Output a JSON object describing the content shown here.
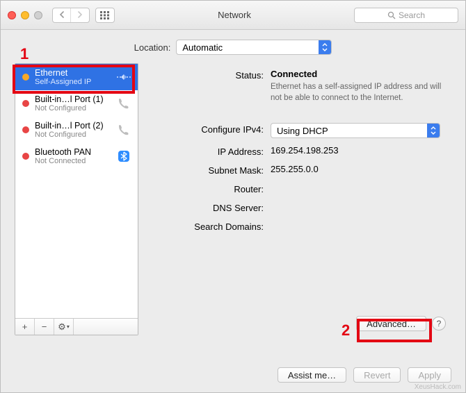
{
  "window": {
    "title": "Network"
  },
  "search": {
    "placeholder": "Search"
  },
  "location": {
    "label": "Location:",
    "value": "Automatic"
  },
  "sidebar": {
    "items": [
      {
        "name": "Ethernet",
        "sub": "Self-Assigned IP",
        "status": "orange",
        "icon": "ethernet-icon",
        "selected": true
      },
      {
        "name": "Built-in…l Port (1)",
        "sub": "Not Configured",
        "status": "red",
        "icon": "modem-icon",
        "selected": false
      },
      {
        "name": "Built-in…l Port (2)",
        "sub": "Not Configured",
        "status": "red",
        "icon": "modem-icon",
        "selected": false
      },
      {
        "name": "Bluetooth PAN",
        "sub": "Not Connected",
        "status": "red",
        "icon": "bluetooth-icon",
        "selected": false
      }
    ],
    "footer": {
      "add": "+",
      "remove": "−",
      "gear": "⚙︎"
    }
  },
  "detail": {
    "status_label": "Status:",
    "status_value": "Connected",
    "status_warn": "Ethernet has a self-assigned IP address and will not be able to connect to the Internet.",
    "configure_label": "Configure IPv4:",
    "configure_value": "Using DHCP",
    "ip_label": "IP Address:",
    "ip_value": "169.254.198.253",
    "subnet_label": "Subnet Mask:",
    "subnet_value": "255.255.0.0",
    "router_label": "Router:",
    "router_value": "",
    "dns_label": "DNS Server:",
    "dns_value": "",
    "search_label": "Search Domains:",
    "search_value": "",
    "advanced": "Advanced…"
  },
  "buttons": {
    "assist": "Assist me…",
    "revert": "Revert",
    "apply": "Apply"
  },
  "annotations": {
    "one": "1",
    "two": "2"
  },
  "watermark": "XeusHack.com"
}
